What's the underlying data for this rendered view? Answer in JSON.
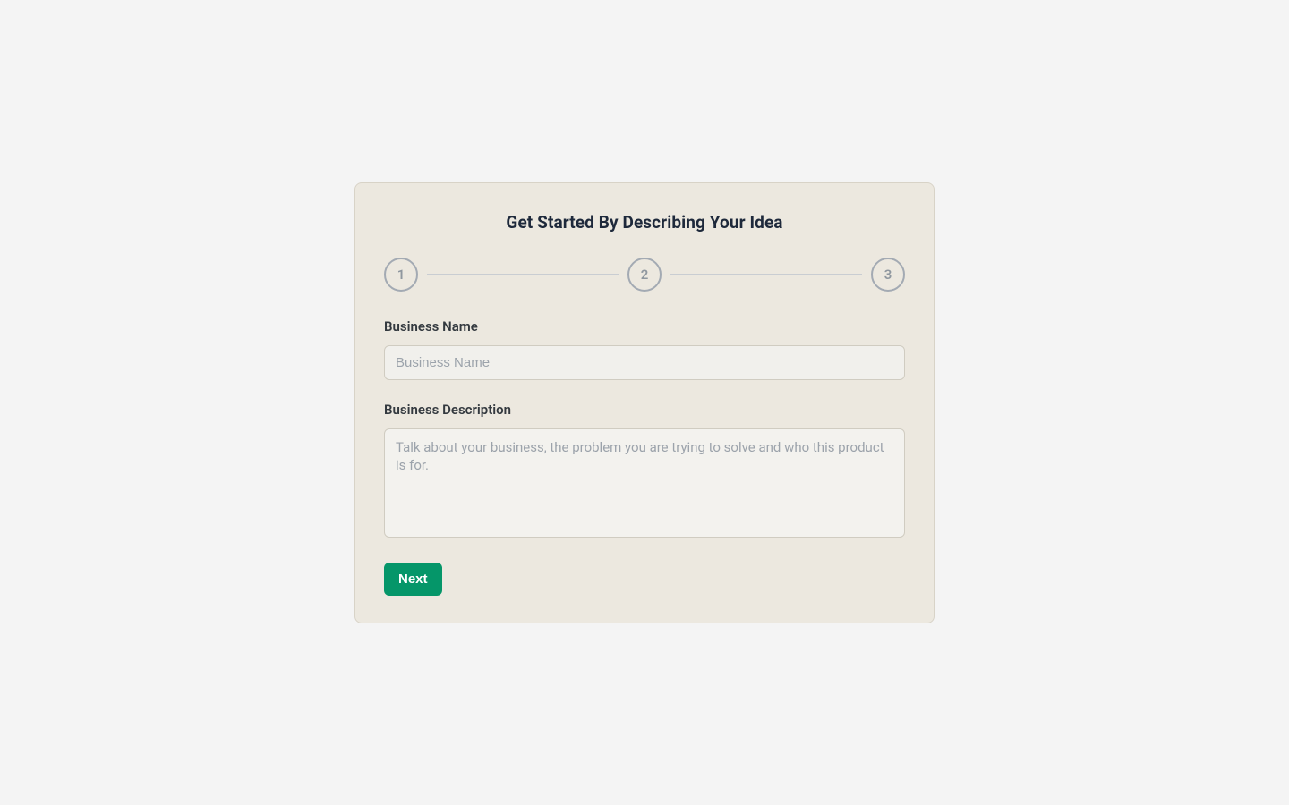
{
  "card": {
    "title": "Get Started By Describing Your Idea"
  },
  "stepper": {
    "steps": [
      "1",
      "2",
      "3"
    ]
  },
  "form": {
    "business_name": {
      "label": "Business Name",
      "placeholder": "Business Name",
      "value": ""
    },
    "business_description": {
      "label": "Business Description",
      "placeholder": "Talk about your business, the problem you are trying to solve and who this product is for.",
      "value": ""
    },
    "next_label": "Next"
  }
}
